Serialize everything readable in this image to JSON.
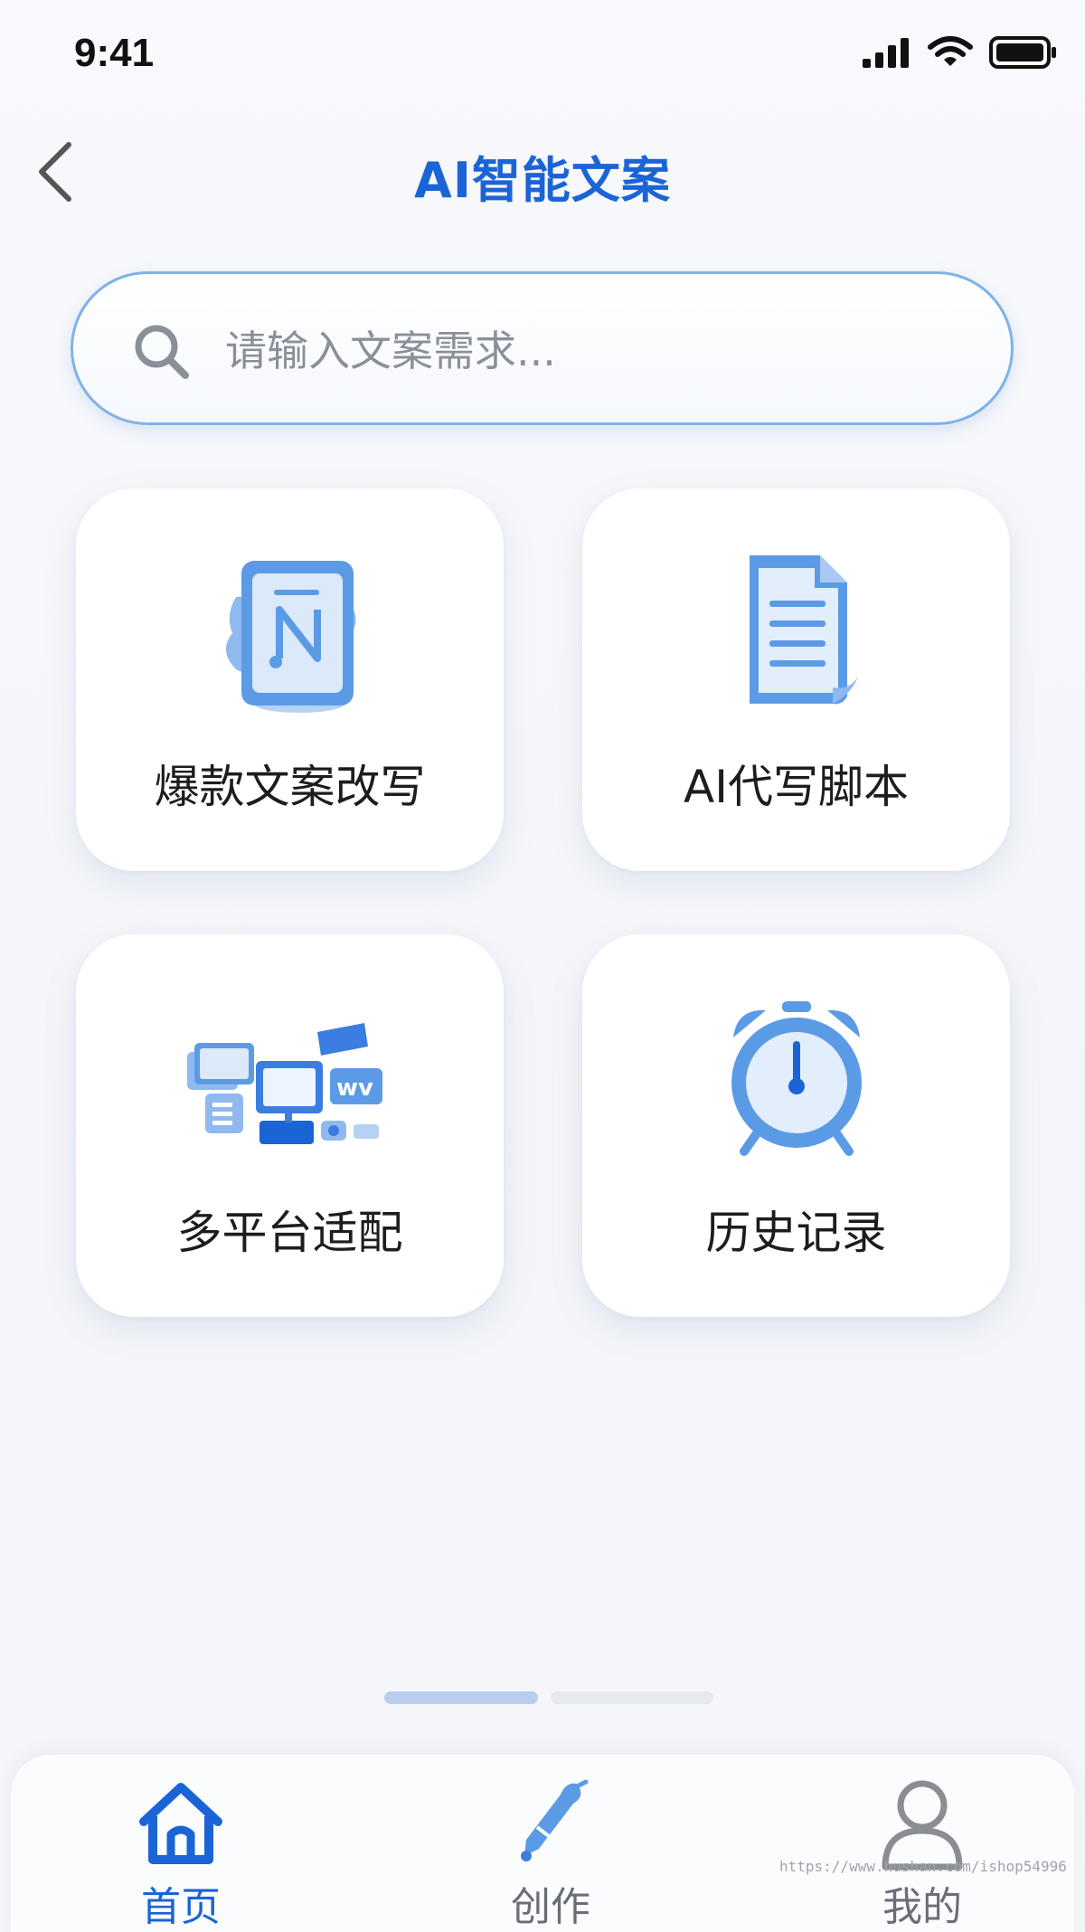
{
  "status_bar": {
    "time": "9:41",
    "icons": [
      "cellular-signal-icon",
      "wifi-icon",
      "battery-icon"
    ]
  },
  "header": {
    "back_icon": "chevron-left-icon",
    "title": "AI智能文案"
  },
  "search": {
    "placeholder": "请输入文案需求...",
    "value": "",
    "icon": "search-icon"
  },
  "features": [
    {
      "label": "爆款文案改写",
      "icon": "document-rewrite-icon"
    },
    {
      "label": "AI代写脚本",
      "icon": "document-lines-icon"
    },
    {
      "label": "多平台适配",
      "icon": "multi-device-icon"
    },
    {
      "label": "历史记录",
      "icon": "alarm-clock-icon"
    }
  ],
  "page_indicator": {
    "current": 1,
    "total": 2
  },
  "tab_bar": {
    "tabs": [
      {
        "label": "首页",
        "icon": "home-icon",
        "active": true
      },
      {
        "label": "创作",
        "icon": "pen-icon",
        "active": false
      },
      {
        "label": "我的",
        "icon": "user-icon",
        "active": false
      }
    ]
  },
  "watermark": "https://www.hushan.com/ishop54996",
  "colors": {
    "accent": "#1b64d6",
    "icon_blue": "#5b9be6",
    "background": "#f4f6fa",
    "card": "#ffffff",
    "search_border": "#7fb2e8"
  }
}
